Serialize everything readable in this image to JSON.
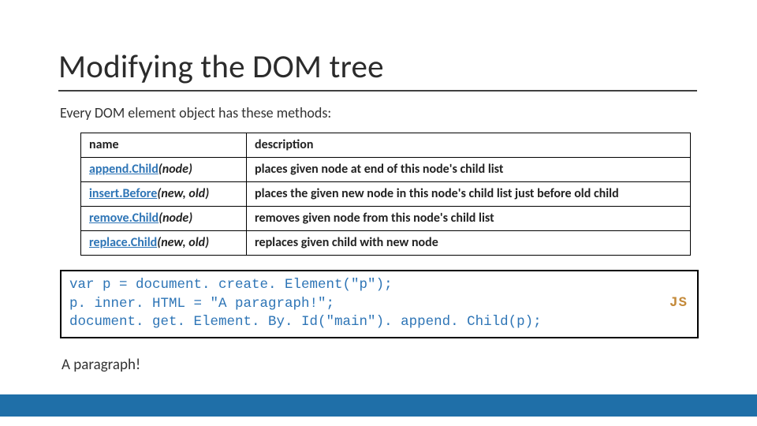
{
  "title": "Modifying the DOM tree",
  "intro": "Every DOM element object has these methods:",
  "table": {
    "headers": {
      "name": "name",
      "description": "description"
    },
    "rows": [
      {
        "method": "append.Child",
        "params": "(node)",
        "desc": "places given node at end of this node's child list"
      },
      {
        "method": "insert.Before",
        "params": "(new, old)",
        "desc": "places the given new node in this node's child list just before old child"
      },
      {
        "method": "remove.Child",
        "params": "(node)",
        "desc": "removes given node from this node's child list"
      },
      {
        "method": "replace.Child",
        "params": "(new, old)",
        "desc": "replaces given child with new node"
      }
    ]
  },
  "code": {
    "line1": "var p = document. create. Element(\"p\");",
    "line2": "p. inner. HTML = \"A paragraph!\";",
    "line3": "document. get. Element. By. Id(\"main\"). append. Child(p);",
    "badge": "JS"
  },
  "output": "A paragraph!"
}
